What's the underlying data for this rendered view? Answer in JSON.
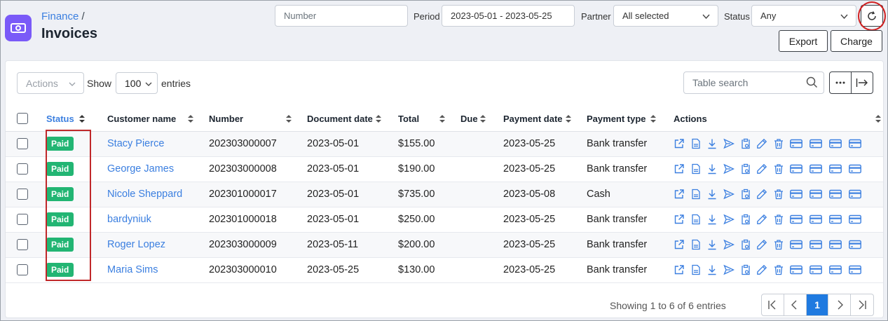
{
  "header": {
    "breadcrumb_parent": "Finance",
    "breadcrumb_sep": "/",
    "title": "Invoices",
    "app_icon": "banknote-icon"
  },
  "filters": {
    "number_placeholder": "Number",
    "period_label": "Period",
    "period_value": "2023-05-01 - 2023-05-25",
    "partner_label": "Partner",
    "partner_value": "All selected",
    "status_label": "Status",
    "status_value": "Any"
  },
  "buttons": {
    "export": "Export",
    "charge": "Charge",
    "refresh_icon": "refresh-icon"
  },
  "toolbar": {
    "actions_label": "Actions",
    "show_label": "Show",
    "entries_value": "100",
    "entries_label": "entries",
    "search_placeholder": "Table search"
  },
  "table": {
    "columns": [
      "Status",
      "Customer name",
      "Number",
      "Document date",
      "Total",
      "Due",
      "Payment date",
      "Payment type",
      "Actions"
    ],
    "rows": [
      {
        "status": "Paid",
        "customer": "Stacy Pierce",
        "number": "202303000007",
        "doc_date": "2023-05-01",
        "total": "$155.00",
        "due": "",
        "pay_date": "2023-05-25",
        "pay_type": "Bank transfer"
      },
      {
        "status": "Paid",
        "customer": "George James",
        "number": "202303000008",
        "doc_date": "2023-05-01",
        "total": "$190.00",
        "due": "",
        "pay_date": "2023-05-25",
        "pay_type": "Bank transfer"
      },
      {
        "status": "Paid",
        "customer": "Nicole Sheppard",
        "number": "202301000017",
        "doc_date": "2023-05-01",
        "total": "$735.00",
        "due": "",
        "pay_date": "2023-05-08",
        "pay_type": "Cash"
      },
      {
        "status": "Paid",
        "customer": "bardyniuk",
        "number": "202301000018",
        "doc_date": "2023-05-01",
        "total": "$250.00",
        "due": "",
        "pay_date": "2023-05-25",
        "pay_type": "Bank transfer"
      },
      {
        "status": "Paid",
        "customer": "Roger Lopez",
        "number": "202303000009",
        "doc_date": "2023-05-11",
        "total": "$200.00",
        "due": "",
        "pay_date": "2023-05-25",
        "pay_type": "Bank transfer"
      },
      {
        "status": "Paid",
        "customer": "Maria Sims",
        "number": "202303000010",
        "doc_date": "2023-05-25",
        "total": "$130.00",
        "due": "",
        "pay_date": "2023-05-25",
        "pay_type": "Bank transfer"
      }
    ],
    "row_action_icons": [
      "open-external-icon",
      "pdf-icon",
      "download-icon",
      "send-icon",
      "clipboard-link-icon",
      "edit-icon",
      "delete-icon",
      "card-icon",
      "card-icon",
      "card-icon",
      "card-icon"
    ]
  },
  "footer": {
    "info": "Showing 1 to 6 of 6 entries",
    "current_page": "1"
  },
  "colors": {
    "accent": "#3b7fe0",
    "paid": "#22b573",
    "app_icon_bg": "#7a5af8",
    "highlight": "#c0282a"
  }
}
